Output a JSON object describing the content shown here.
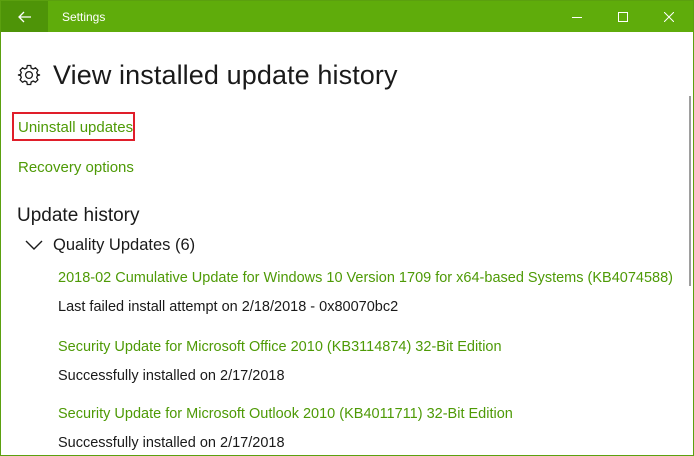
{
  "window": {
    "title": "Settings"
  },
  "page": {
    "title": "View installed update history"
  },
  "links": {
    "uninstall": "Uninstall updates",
    "recovery": "Recovery options"
  },
  "history": {
    "title": "Update history",
    "group_label": "Quality Updates (6)",
    "updates": [
      {
        "name": "2018-02 Cumulative Update for Windows 10 Version 1709 for x64-based Systems (KB4074588)",
        "status": "Last failed install attempt on 2/18/2018 - 0x80070bc2"
      },
      {
        "name": "Security Update for Microsoft Office 2010 (KB3114874) 32-Bit Edition",
        "status": "Successfully installed on 2/17/2018"
      },
      {
        "name": "Security Update for Microsoft Outlook 2010 (KB4011711) 32-Bit Edition",
        "status": "Successfully installed on 2/17/2018"
      }
    ]
  },
  "icons": {
    "back": "back-arrow-icon",
    "minimize": "minimize-icon",
    "maximize": "maximize-icon",
    "close": "close-icon",
    "settings": "gear-icon",
    "expand": "chevron-down-icon"
  },
  "colors": {
    "accent": "#5fac0b",
    "link": "#4e9a06",
    "highlight_border": "#e01e2a"
  }
}
